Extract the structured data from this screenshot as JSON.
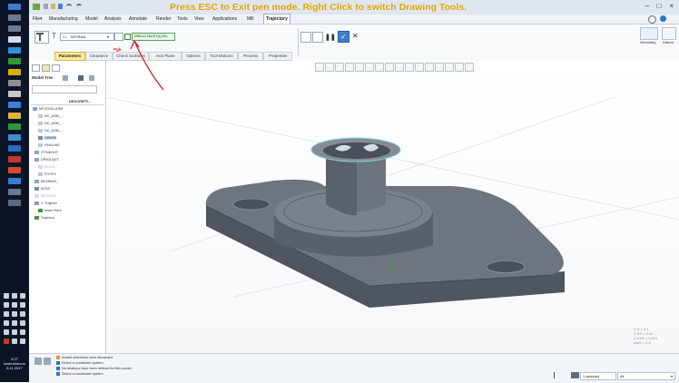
{
  "overlay_message": "Press ESC to Exit pen mode.  Right Click to switch Drawing Tools.",
  "menu": {
    "items": [
      "File▾",
      "Manufacturing",
      "Model",
      "Analysis",
      "Annotate",
      "Render",
      "Tools",
      "View",
      "Applications",
      "Mill",
      "Trajectory"
    ],
    "active": "Trajectory"
  },
  "ribbon": {
    "tool_name": "TAPIRAM",
    "coord_ref": "DRILLD FACEY(1) ID=",
    "pen_annotation": "Pgb",
    "right_group": [
      {
        "label": "Geometry"
      },
      {
        "label": "Datum"
      }
    ]
  },
  "subtabs": [
    "Parameters",
    "Clearance",
    "Check Surfaces",
    "Axis Plane",
    "Options",
    "Tool Motions",
    "Process",
    "Properties"
  ],
  "active_subtab": "Parameters",
  "model_tree": {
    "title": "Model Tree",
    "column": "DESCRIPTI...",
    "rows": [
      {
        "label": "MFG0001.ASM",
        "depth": 0
      },
      {
        "label": "NC_ASM_...",
        "depth": 1
      },
      {
        "label": "NC_ASM_...",
        "depth": 1
      },
      {
        "label": "NC_ASM_...",
        "depth": 1
      },
      {
        "label": "DRW00",
        "depth": 1
      },
      {
        "label": "FINALIKE",
        "depth": 1
      },
      {
        "label": "STRAIGHT",
        "depth": 1
      },
      {
        "label": "DP0013(XT",
        "depth": 1
      },
      {
        "label": "ROGH...",
        "depth": 1
      },
      {
        "label": "FIXTP1",
        "depth": 1
      },
      {
        "label": "BEARING_",
        "depth": 1
      },
      {
        "label": "ACS0",
        "depth": 1
      },
      {
        "label": "MFG0001",
        "depth": 1
      },
      {
        "label": "1. Trajecto",
        "depth": 1
      },
      {
        "label": "Insert Here",
        "depth": 1
      },
      {
        "label": "Trajector",
        "depth": 1
      }
    ]
  },
  "precision": [
    "X.X = 0.1",
    "X.XX = 0.01",
    "X.XXX = 0.001",
    "ANG = 0.5"
  ],
  "status_messages": [
    {
      "text": "Invalid selections were discarded.",
      "icon": "warning-icon",
      "color": "#e0a000"
    },
    {
      "text": "Select a coordinate system.",
      "icon": "info-icon",
      "color": "#2d74c4"
    },
    {
      "text": "No relations have been defined for this model.",
      "icon": "info-icon",
      "color": "#2d74c4"
    },
    {
      "text": "Select a coordinate system.",
      "icon": "info-icon",
      "color": "#2d74c4"
    }
  ],
  "selection": {
    "count_text": "1 selected",
    "filter": "All"
  },
  "clock": {
    "time": "9.27",
    "day": "keskiviikkona",
    "date": "8.11.2017"
  },
  "colors": {
    "model_gray": "#6e7580",
    "model_dark": "#4a5059",
    "highlight": "#7fd4e8",
    "accent": "#e0a000",
    "active_subtab": "#fde99a"
  }
}
